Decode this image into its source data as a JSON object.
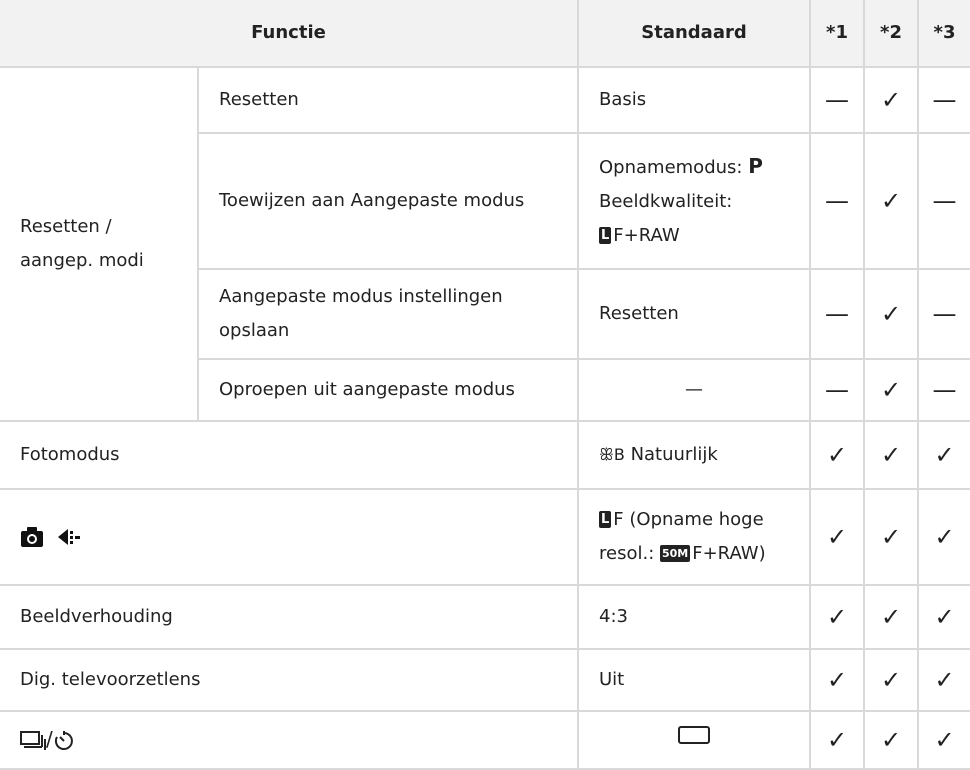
{
  "header": {
    "functie": "Functie",
    "standaard": "Standaard",
    "c1": "*1",
    "c2": "*2",
    "c3": "*3"
  },
  "marks": {
    "check": "✓",
    "dash": "—"
  },
  "group": {
    "label": "Resetten / aangep. modi",
    "rows": [
      {
        "sub": "Resetten",
        "std": "Basis",
        "c1": "—",
        "c2": "✓",
        "c3": "—"
      },
      {
        "sub": "Toewijzen aan Aangepaste modus",
        "std_line1": "Opnamemodus:",
        "std_line1_value": "P",
        "std_line2": "Beeldkwaliteit:",
        "std_line3_badge": "L",
        "std_line3": "F+RAW",
        "c1": "—",
        "c2": "✓",
        "c3": "—"
      },
      {
        "sub": "Aangepaste modus instellingen opslaan",
        "std": "Resetten",
        "c1": "—",
        "c2": "✓",
        "c3": "—"
      },
      {
        "sub": "Oproepen uit aangepaste modus",
        "std": "—",
        "c1": "—",
        "c2": "✓",
        "c3": "—"
      }
    ]
  },
  "rows": [
    {
      "func": "Fotomodus",
      "std_icon": "ꕥB",
      "std": "Natuurlijk",
      "c1": "✓",
      "c2": "✓",
      "c3": "✓"
    },
    {
      "func_icon": "camera-quality-icon",
      "std_badge": "L",
      "std_line1": "F (Opname hoge",
      "std_line2_prefix": "resol.: ",
      "std_line2_badge": "50M",
      "std_line2": "F+RAW)",
      "c1": "✓",
      "c2": "✓",
      "c3": "✓"
    },
    {
      "func": "Beeldverhouding",
      "std": "4:3",
      "c1": "✓",
      "c2": "✓",
      "c3": "✓"
    },
    {
      "func": "Dig. televoorzetlens",
      "std": "Uit",
      "c1": "✓",
      "c2": "✓",
      "c3": "✓"
    },
    {
      "func": "⧉/ɕ",
      "std_icon": "single-frame-icon",
      "c1": "✓",
      "c2": "✓",
      "c3": "✓"
    }
  ]
}
